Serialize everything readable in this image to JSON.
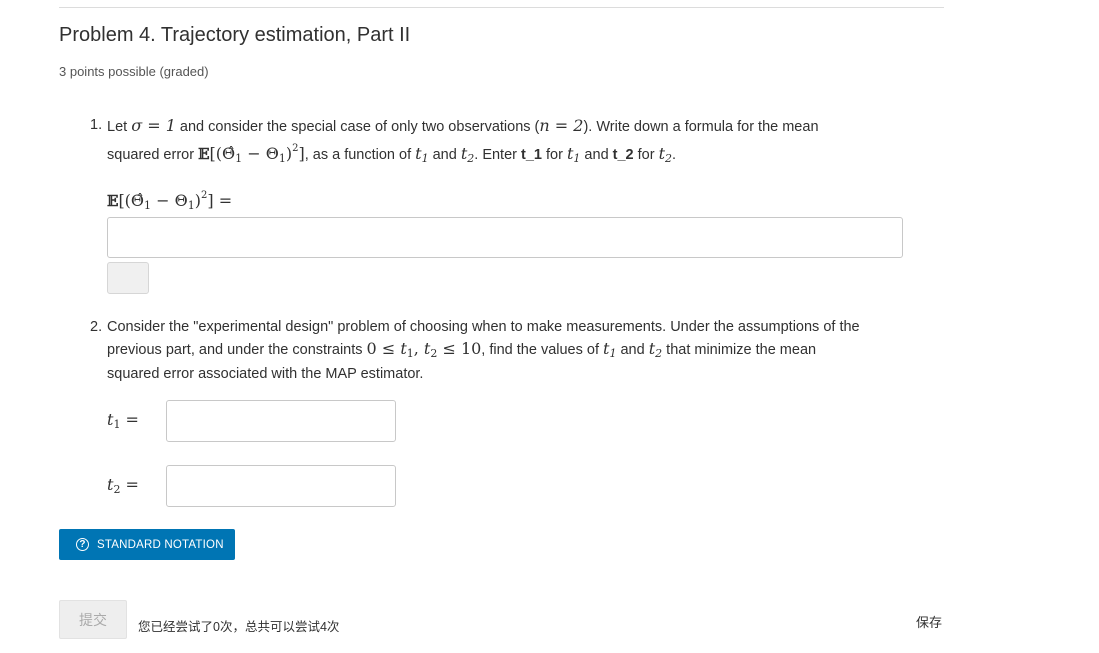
{
  "problem": {
    "title": "Problem 4. Trajectory estimation, Part II",
    "points": "3 points possible (graded)"
  },
  "q1": {
    "number": "1.",
    "t1": "Let ",
    "sigma_eq": "σ = 1",
    "t2": " and consider the special case of only two observations (",
    "n_eq": "n = 2",
    "t3": "). Write down a formula for the mean",
    "t4": "squared error ",
    "t5": ", as a function of ",
    "t6": " and ",
    "t7": ". Enter ",
    "t1_code": "t_1",
    "t8": " for ",
    "t9": " and ",
    "t2_code": "t_2",
    "t10": " for ",
    "t11": ".",
    "answer_value": ""
  },
  "q2": {
    "number": "2.",
    "line1": "Consider the \"experimental design\" problem of choosing when to make measurements. Under the assumptions of the",
    "line2a": "previous part, and under the constraints ",
    "line2b": ", find the values of ",
    "line2c": " and ",
    "line2d": " that minimize the mean",
    "line3": "squared error associated with the MAP estimator.",
    "t1_value": "",
    "t2_value": ""
  },
  "buttons": {
    "notation": "STANDARD NOTATION",
    "submit": "提交",
    "save": "保存"
  },
  "status": {
    "attempts": "您已经尝试了0次，总共可以尝试4次"
  },
  "colors": {
    "accent": "#0075b4"
  }
}
